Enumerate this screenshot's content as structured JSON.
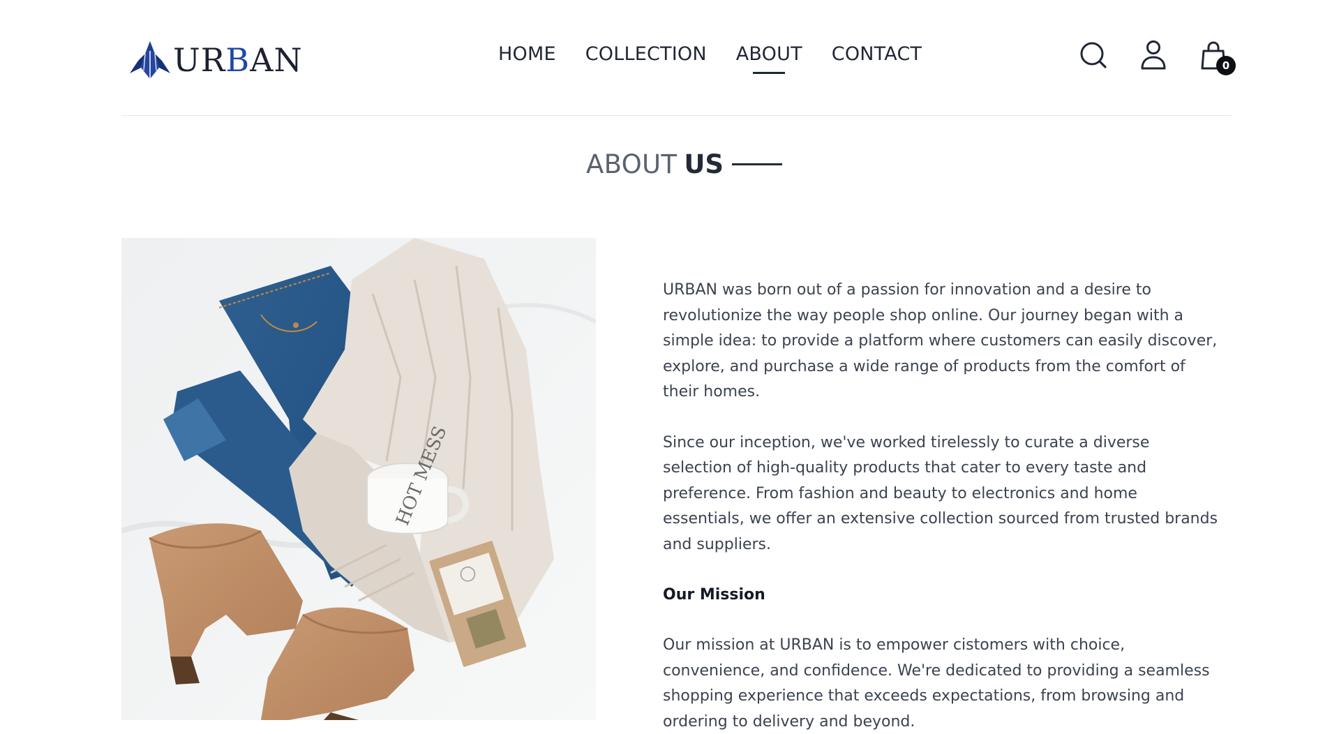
{
  "brand": {
    "logo_text_a": "UR",
    "logo_text_b": "B",
    "logo_text_c": "AN",
    "accent_color": "#1d49a6"
  },
  "nav": {
    "items": [
      {
        "label": "HOME",
        "active": false
      },
      {
        "label": "COLLECTION",
        "active": false
      },
      {
        "label": "ABOUT",
        "active": true
      },
      {
        "label": "CONTACT",
        "active": false
      }
    ]
  },
  "header_icons": {
    "search": "search-icon",
    "account": "user-icon",
    "cart": "shopping-bag-icon",
    "cart_count": "0"
  },
  "section": {
    "title_light": "ABOUT",
    "title_bold": "US"
  },
  "about": {
    "paragraph_1": "URBAN was born out of a passion for innovation and a desire to revolutionize the way people shop online. Our journey began with a simple idea: to provide a platform where customers can easily discover, explore, and purchase a wide range of products from the comfort of their homes.",
    "paragraph_2": "Since our inception, we've worked tirelessly to curate a diverse selection of high-quality products that cater to every taste and preference. From fashion and beauty to electronics and home essentials, we offer an extensive collection sourced from trusted brands and suppliers.",
    "mission_heading": "Our Mission",
    "mission_text": "Our mission at URBAN is to empower cistomers with choice, convenience, and confidence. We're dedicated to providing a seamless shopping experience that exceeds expectations, from browsing and ordering to delivery and beyond."
  },
  "photo": {
    "mug_text": "HOT MESS"
  }
}
